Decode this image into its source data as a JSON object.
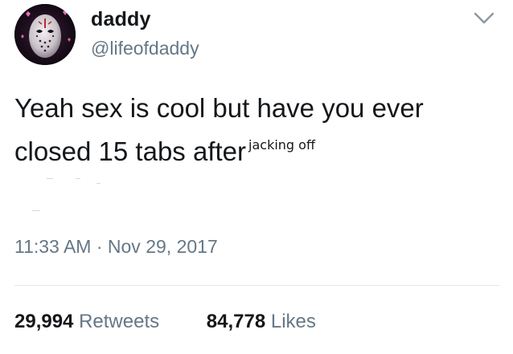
{
  "user": {
    "display_name": "daddy",
    "handle": "@lifeofdaddy",
    "avatar_icon": "hockey-mask-avatar"
  },
  "tweet": {
    "text_main": "Yeah sex is cool but have you ever closed 15 tabs after",
    "text_small": "jacking off"
  },
  "meta": {
    "timestamp": "11:33 AM · Nov 29, 2017"
  },
  "stats": {
    "retweets_count": "29,994",
    "retweets_label": "Retweets",
    "likes_count": "84,778",
    "likes_label": "Likes"
  },
  "icons": {
    "menu": "chevron-down-icon"
  },
  "colors": {
    "text_primary": "#14171a",
    "text_secondary": "#657786",
    "divider": "#e1e8ed"
  }
}
